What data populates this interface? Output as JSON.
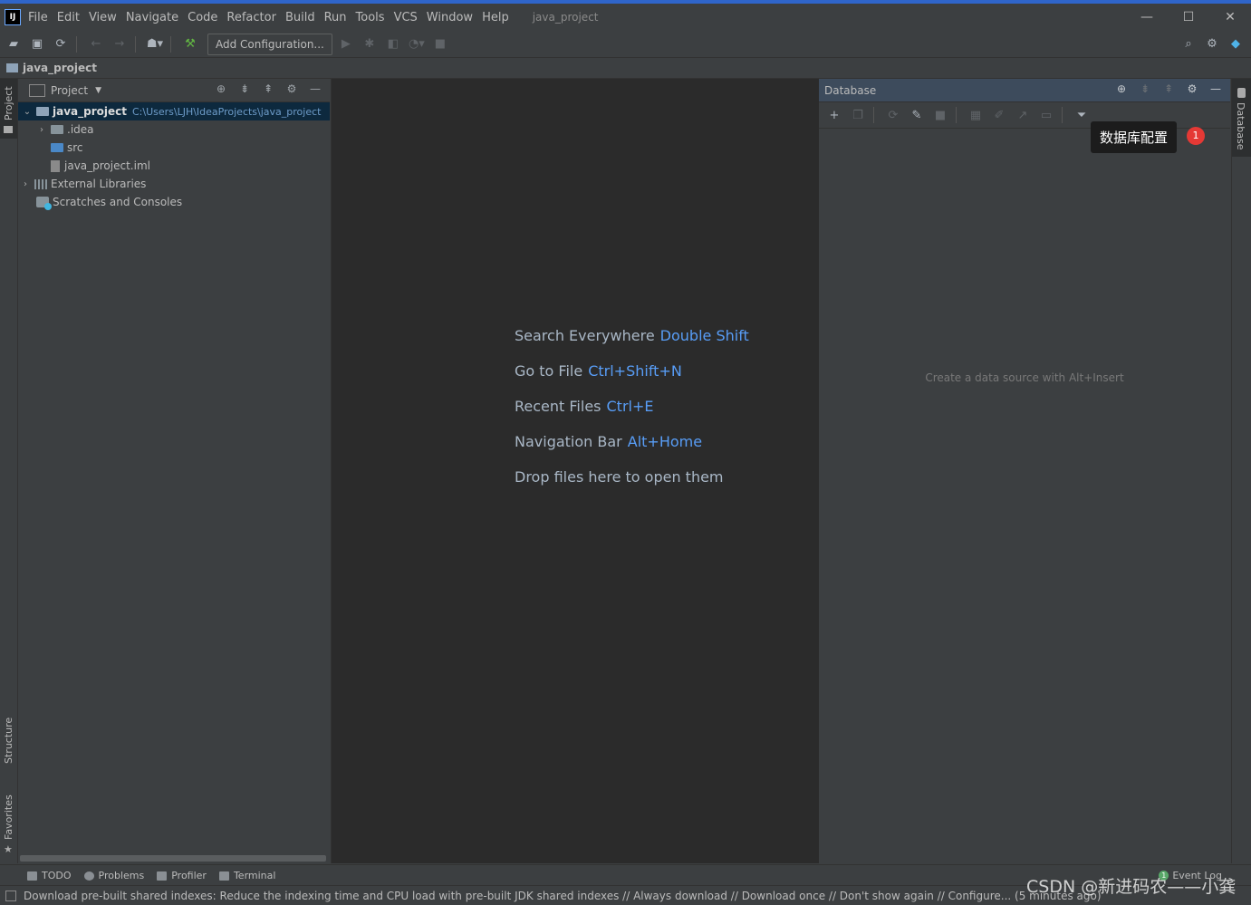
{
  "window": {
    "project_title": "java_project",
    "logo_text": "IJ",
    "controls": [
      "—",
      "☐",
      "✕"
    ]
  },
  "menu": [
    "File",
    "Edit",
    "View",
    "Navigate",
    "Code",
    "Refactor",
    "Build",
    "Run",
    "Tools",
    "VCS",
    "Window",
    "Help"
  ],
  "toolbar": {
    "add_configuration_label": "Add Configuration..."
  },
  "breadcrumb": {
    "project": "java_project"
  },
  "left_stripe": {
    "project_tab": "Project",
    "structure_tab": "Structure",
    "favorites_tab": "Favorites"
  },
  "project_panel": {
    "title": "Project",
    "tree": [
      {
        "label": "java_project",
        "path": "C:\\Users\\LJH\\IdeaProjects\\java_project"
      },
      {
        "label": ".idea"
      },
      {
        "label": "src"
      },
      {
        "label": "java_project.iml"
      },
      {
        "label": "External Libraries"
      },
      {
        "label": "Scratches and Consoles"
      }
    ]
  },
  "editor": {
    "hints": [
      {
        "text": "Search Everywhere",
        "key": "Double Shift"
      },
      {
        "text": "Go to File",
        "key": "Ctrl+Shift+N"
      },
      {
        "text": "Recent Files",
        "key": "Ctrl+E"
      },
      {
        "text": "Navigation Bar",
        "key": "Alt+Home"
      },
      {
        "text": "Drop files here to open them",
        "key": ""
      }
    ]
  },
  "database_panel": {
    "title": "Database",
    "empty_text": "Create a data source with Alt+Insert",
    "tooltip": "数据库配置",
    "badge": "1"
  },
  "right_stripe": {
    "database_tab": "Database"
  },
  "bottom_tabs": [
    "TODO",
    "Problems",
    "Profiler",
    "Terminal"
  ],
  "event_log": {
    "label": "Event Log",
    "count": "1"
  },
  "status": {
    "message": "Download pre-built shared indexes: Reduce the indexing time and CPU load with pre-built JDK shared indexes // Always download // Download once // Don't show again // Configure... (5 minutes ago)"
  },
  "watermark": "CSDN @新进码农——小龚",
  "colors": {
    "accent": "#589df6",
    "background": "#3c3f41",
    "editor": "#2b2b2b",
    "badge": "#e53935"
  }
}
